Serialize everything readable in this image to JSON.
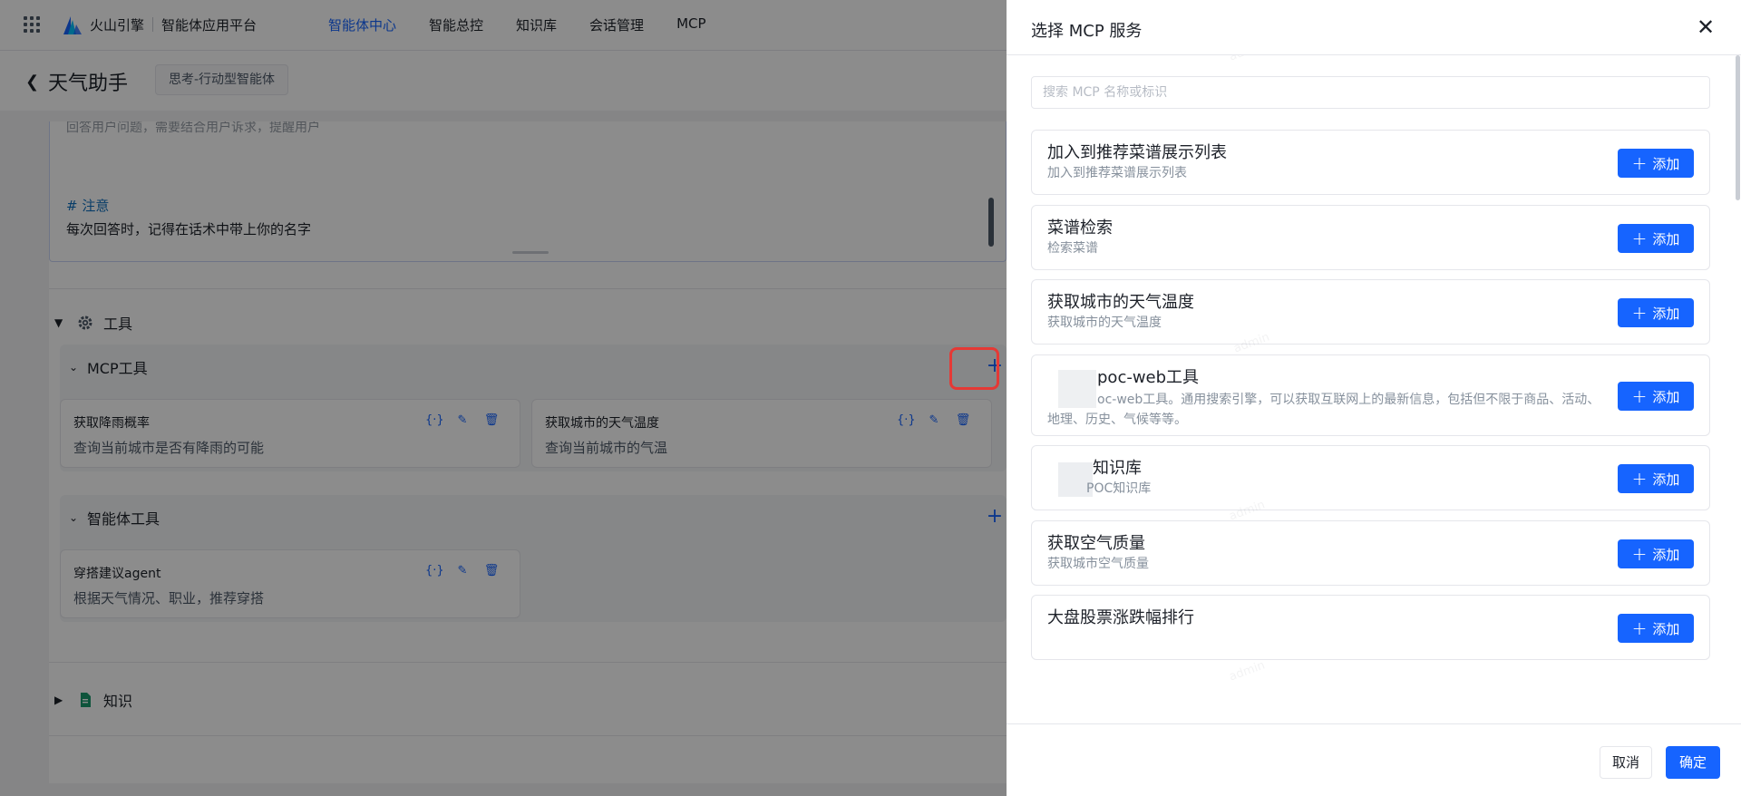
{
  "topbar": {
    "brand": "火山引擎",
    "platform": "智能体应用平台",
    "nav": [
      {
        "label": "智能体中心",
        "active": true
      },
      {
        "label": "智能总控",
        "active": false
      },
      {
        "label": "知识库",
        "active": false
      },
      {
        "label": "会话管理",
        "active": false
      },
      {
        "label": "MCP",
        "active": false
      }
    ]
  },
  "page": {
    "title": "天气助手",
    "agent_type": "思考-行动型智能体"
  },
  "prompt": {
    "clipped_line": "回答用户问题，需要结合用户诉求，提醒用户",
    "note_heading": "# 注意",
    "note_text": "每次回答时，记得在话术中带上你的名字"
  },
  "tools_section": {
    "label": "工具",
    "mcp_group": {
      "title": "MCP工具",
      "cards": [
        {
          "name": "获取降雨概率",
          "desc": "查询当前城市是否有降雨的可能"
        },
        {
          "name": "获取城市的天气温度",
          "desc": "查询当前城市的气温"
        }
      ]
    },
    "agent_group": {
      "title": "智能体工具",
      "cards": [
        {
          "name": "穿搭建议agent",
          "desc": "根据天气情况、职业，推荐穿搭"
        }
      ]
    }
  },
  "knowledge_section": {
    "label": "知识"
  },
  "drawer": {
    "title": "选择 MCP 服务",
    "search_placeholder": "搜索 MCP 名称或标识",
    "add_label": "添加",
    "services": [
      {
        "name": "加入到推荐菜谱展示列表",
        "desc": "加入到推荐菜谱展示列表"
      },
      {
        "name": "菜谱检索",
        "desc": "检索菜谱"
      },
      {
        "name": "获取城市的天气温度",
        "desc": "获取城市的天气温度"
      },
      {
        "name": "poc-web工具",
        "desc": "oc-web工具。通用搜索引擎，可以获取互联网上的最新信息，包括但不限于商品、活动、地理、历史、气候等等。"
      },
      {
        "name": "知识库",
        "desc": "POC知识库"
      },
      {
        "name": "获取空气质量",
        "desc": "获取城市空气质量"
      },
      {
        "name": "大盘股票涨跌幅排行",
        "desc": ""
      }
    ],
    "cancel_label": "取消",
    "confirm_label": "确定"
  },
  "watermark": "admin"
}
